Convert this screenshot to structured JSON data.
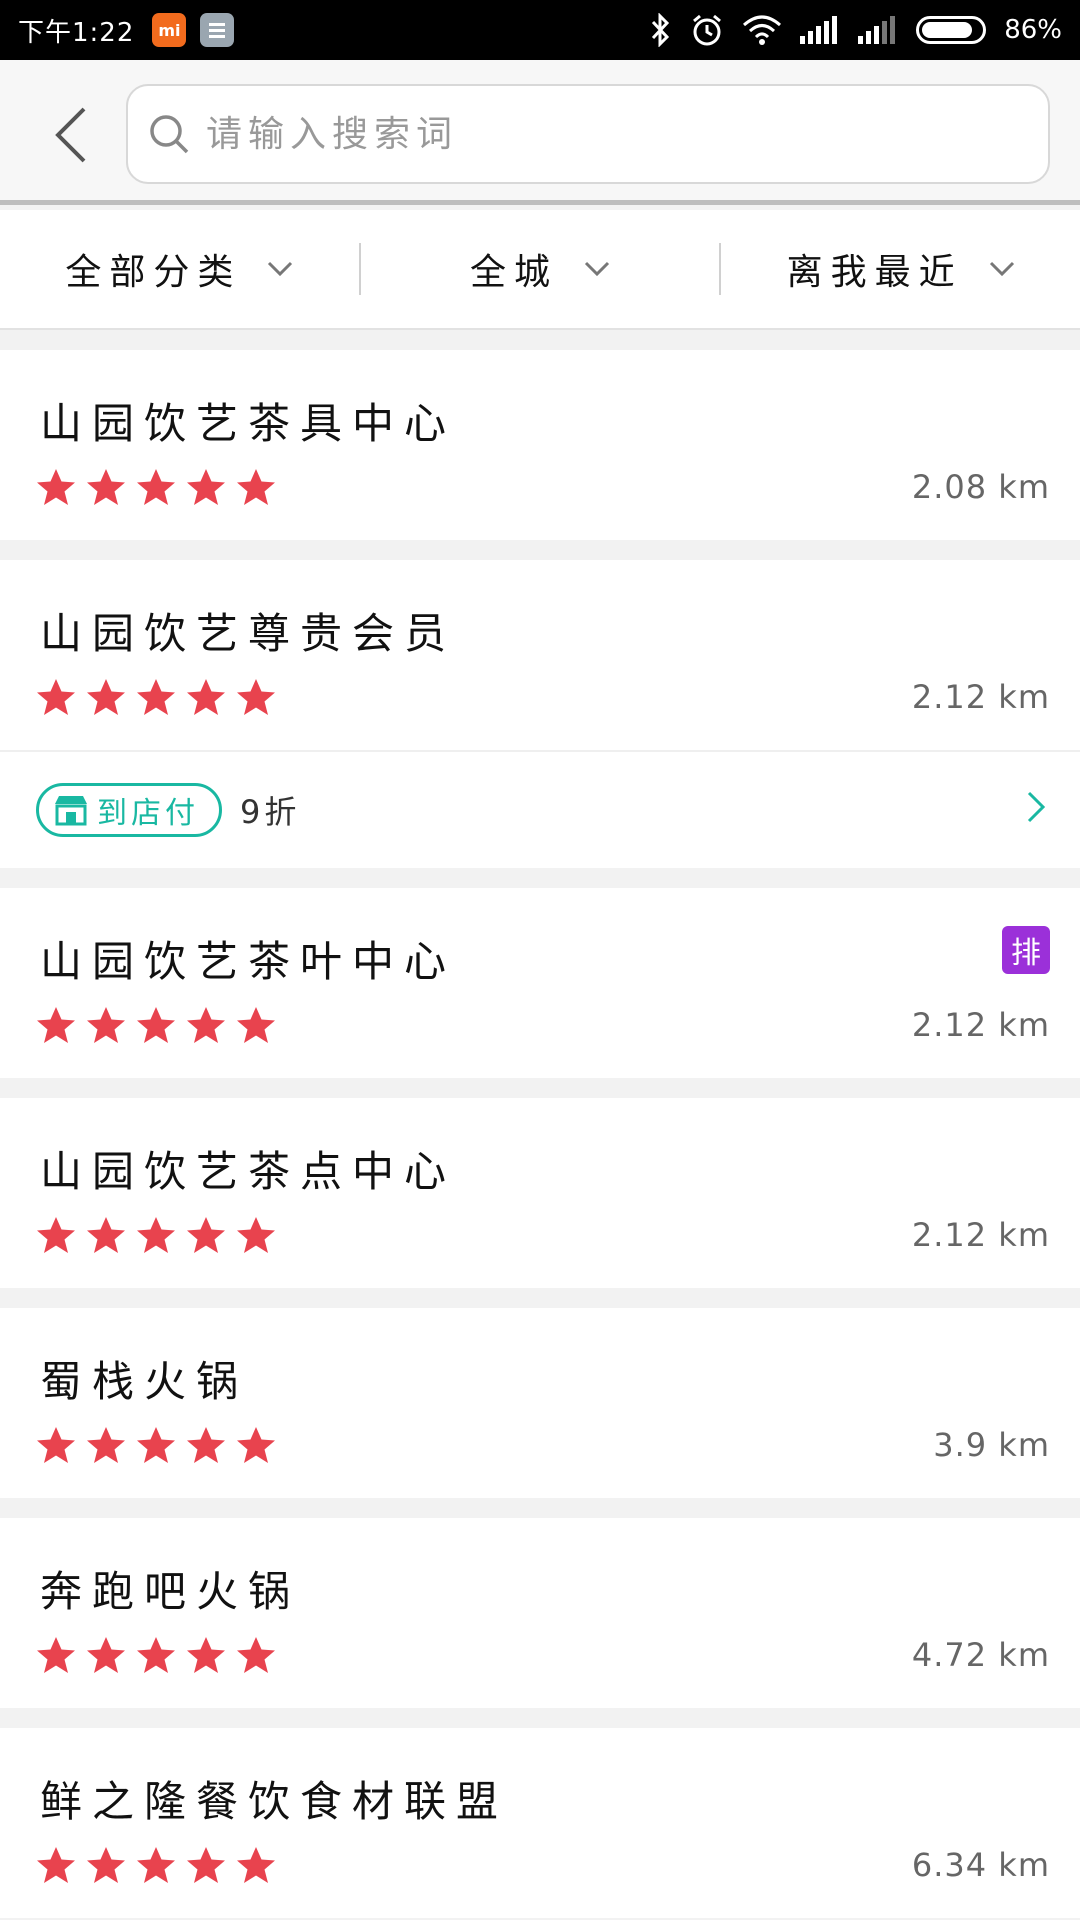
{
  "status_bar": {
    "time": "下午1:22",
    "battery": "86%",
    "battery_level": 0.86,
    "icons": [
      "mi-app-icon",
      "notes-app-icon",
      "bluetooth-icon",
      "alarm-icon",
      "wifi-icon",
      "signal-icon",
      "signal-icon"
    ]
  },
  "header": {
    "back_icon": "chevron-left-icon",
    "search_placeholder": "请输入搜索词",
    "search_value": "",
    "search_icon": "search-icon"
  },
  "filters": [
    {
      "label": "全部分类"
    },
    {
      "label": "全城"
    },
    {
      "label": "离我最近"
    }
  ],
  "shops": [
    {
      "name": "山园饮艺茶具中心",
      "rating": 5,
      "distance": "2.08 km"
    },
    {
      "name": "山园饮艺尊贵会员",
      "rating": 5,
      "distance": "2.12 km",
      "promo": {
        "tag": "到店付",
        "discount": "9折"
      }
    },
    {
      "name": "山园饮艺茶叶中心",
      "rating": 5,
      "distance": "2.12 km",
      "badge": "排"
    },
    {
      "name": "山园饮艺茶点中心",
      "rating": 5,
      "distance": "2.12 km"
    },
    {
      "name": "蜀栈火锅",
      "rating": 5,
      "distance": "3.9 km"
    },
    {
      "name": "奔跑吧火锅",
      "rating": 5,
      "distance": "4.72 km"
    },
    {
      "name": "鲜之隆餐饮食材联盟",
      "rating": 5,
      "distance": "6.34 km"
    }
  ],
  "colors": {
    "star": "#e8434e",
    "teal": "#19b8a2",
    "badge_purple": "#9b30d9"
  }
}
